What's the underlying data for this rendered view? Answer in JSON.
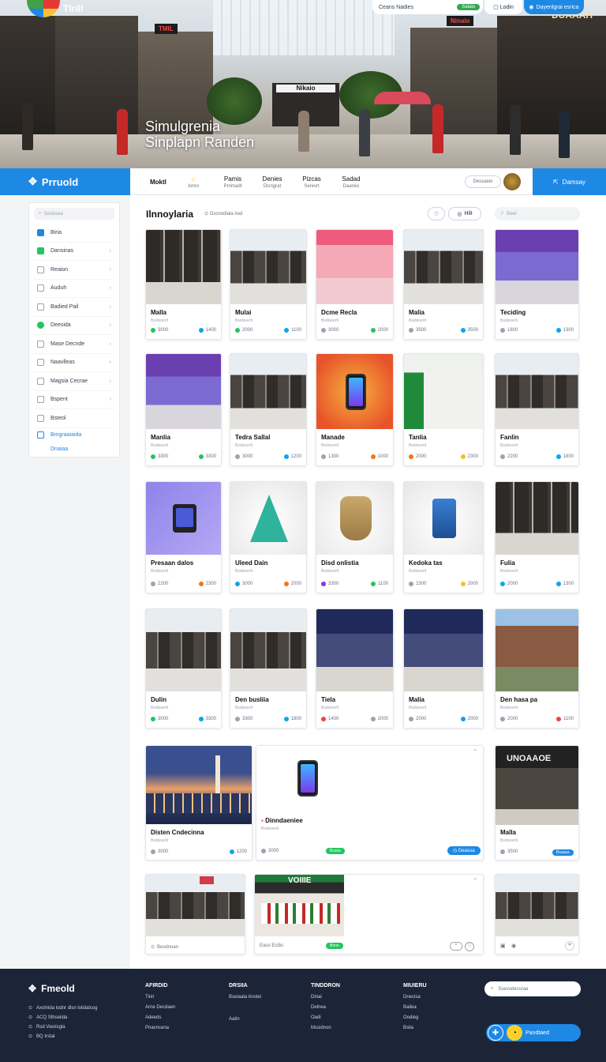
{
  "hero": {
    "logo_text": "Tlrill",
    "title_line1": "Simulgrenia",
    "title_line2": "Sinplapn Randen",
    "center_sign": "Nikaio",
    "signs": [
      "DUAAAH",
      "TMIL",
      "Ninaio"
    ],
    "search_text": "Ceans Nadies",
    "search_button": "Salaio",
    "login_label": "Lodin",
    "register_label": "Dayenlgrai esrica"
  },
  "nav": {
    "brand": "Prruold",
    "links": [
      {
        "label": "Moktl",
        "sub": ""
      },
      {
        "label": "",
        "sub": "Amro"
      },
      {
        "label": "Pamis",
        "sub": "Prnmadt"
      },
      {
        "label": "Denies",
        "sub": "Disngrat"
      },
      {
        "label": "Pizcas",
        "sub": "Serevrt"
      },
      {
        "label": "Sadad",
        "sub": "Daaries"
      }
    ],
    "mini_search": "Dessaeio",
    "cta": "Damsay"
  },
  "sidebar": {
    "search_placeholder": "Sesiosee",
    "items": [
      {
        "label": "Biria",
        "icon": "square-blue-icon",
        "chevron": false
      },
      {
        "label": "Dansinas",
        "icon": "square-green-icon",
        "chevron": true
      },
      {
        "label": "Reaion",
        "icon": "user-icon",
        "chevron": true
      },
      {
        "label": "Auduh",
        "icon": "person-icon",
        "chevron": true
      },
      {
        "label": "Badied Pail",
        "icon": "bell-icon",
        "chevron": true
      },
      {
        "label": "Deesida",
        "icon": "circle-check-icon",
        "chevron": true
      },
      {
        "label": "Mase Decnde",
        "icon": "heart-icon",
        "chevron": true
      },
      {
        "label": "Naavlleas",
        "icon": "box-icon",
        "chevron": true
      },
      {
        "label": "Magsia Cecrae",
        "icon": "shield-icon",
        "chevron": true
      },
      {
        "label": "Bspent",
        "icon": "file-icon",
        "chevron": true
      },
      {
        "label": "Bsteol",
        "icon": "grid-icon",
        "chevron": false
      }
    ],
    "links": [
      "Bmgraaiaida",
      "Dnaiaa"
    ]
  },
  "main": {
    "title": "Ilnnoylaria",
    "subtitle": "Gscnndlala lred",
    "filter_label": "Hilt",
    "search_placeholder": "Sleel"
  },
  "cards": [
    {
      "title": "Malla",
      "sub": "Bsdisoerlt",
      "a": "3000",
      "b": "1400",
      "ca": "#22c55e",
      "cb": "#0ea5e9"
    },
    {
      "title": "Mulai",
      "sub": "Bsdisoerlt",
      "a": "2000",
      "b": "1100",
      "ca": "#22c55e",
      "cb": "#0ea5e9"
    },
    {
      "title": "Dcme Recla",
      "sub": "Bsdisoerlt",
      "a": "3000",
      "b": "2000",
      "ca": "#9ca3af",
      "cb": "#22c55e"
    },
    {
      "title": "Malia",
      "sub": "Bsdisoerlt",
      "a": "3500",
      "b": "3500",
      "ca": "#9ca3af",
      "cb": "#0ea5e9"
    },
    {
      "title": "Teciding",
      "sub": "Bsdisoerlt",
      "a": "1800",
      "b": "1300",
      "ca": "#9ca3af",
      "cb": "#0ea5e9"
    },
    {
      "title": "Manlia",
      "sub": "Bsdisoerlt",
      "a": "3300",
      "b": "3300",
      "ca": "#22c55e",
      "cb": "#22c55e"
    },
    {
      "title": "Tedra Sallal",
      "sub": "Bsdisoerlt",
      "a": "3000",
      "b": "1200",
      "ca": "#9ca3af",
      "cb": "#0ea5e9"
    },
    {
      "title": "Manade",
      "sub": "Bsdisoerlt",
      "a": "1300",
      "b": "1000",
      "ca": "#9ca3af",
      "cb": "#f97316"
    },
    {
      "title": "Tanlia",
      "sub": "Bsdisoerlt",
      "a": "2000",
      "b": "2300",
      "ca": "#f97316",
      "cb": "#fbbf24"
    },
    {
      "title": "Fanlin",
      "sub": "Bsdisoerlt",
      "a": "2200",
      "b": "1800",
      "ca": "#9ca3af",
      "cb": "#0ea5e9"
    },
    {
      "title": "Presaan dalos",
      "sub": "Bsdisoerlt",
      "a": "2200",
      "b": "2300",
      "ca": "#9ca3af",
      "cb": "#f97316"
    },
    {
      "title": "Uleed Dain",
      "sub": "Bsdisoerlt",
      "a": "3000",
      "b": "2000",
      "ca": "#0ea5e9",
      "cb": "#f97316"
    },
    {
      "title": "Disd onlistia",
      "sub": "Bsdisoerlt",
      "a": "3300",
      "b": "1100",
      "ca": "#7c3aed",
      "cb": "#22c55e"
    },
    {
      "title": "Kedoka tas",
      "sub": "Bsdisoerlt",
      "a": "2300",
      "b": "2000",
      "ca": "#9ca3af",
      "cb": "#fbbf24"
    },
    {
      "title": "Fulia",
      "sub": "Bsdisoerlt",
      "a": "2000",
      "b": "1300",
      "ca": "#0ea5e9",
      "cb": "#0ea5e9"
    },
    {
      "title": "Dulin",
      "sub": "Bsdisoerlt",
      "a": "3000",
      "b": "3300",
      "ca": "#22c55e",
      "cb": "#0ea5e9"
    },
    {
      "title": "Den busliia",
      "sub": "Bsdisoerlt",
      "a": "3300",
      "b": "1800",
      "ca": "#9ca3af",
      "cb": "#0ea5e9"
    },
    {
      "title": "Tiela",
      "sub": "Bsdisoerlt",
      "a": "1400",
      "b": "2000",
      "ca": "#ef4444",
      "cb": "#9ca3af"
    },
    {
      "title": "Malia",
      "sub": "Bsdisoerlt",
      "a": "2000",
      "b": "2000",
      "ca": "#9ca3af",
      "cb": "#0ea5e9"
    },
    {
      "title": "Den hasa pa",
      "sub": "Bsdisoerlt",
      "a": "2000",
      "b": "1100",
      "ca": "#9ca3af",
      "cb": "#ef4444"
    }
  ],
  "wide": {
    "city_title": "Disten Cndecinna",
    "city_sub": "Bsdisoerlt",
    "city_a": "3000",
    "city_b": "1200",
    "phone_title": "Dinndaeniee",
    "phone_sub": "Bsdisoerlt",
    "phone_a": "3000",
    "phone_badge": "Bcans",
    "phone_btn": "Deasua",
    "store_title": "Malla",
    "store_sub": "Bsdisoerlt",
    "store_a": "3500",
    "store_btn": "Bsaasa",
    "store_sign": "UNOAAOE"
  },
  "row6": {
    "left_label": "Besdnoan",
    "mid_sign": "VOIIIE",
    "mid_label": "Easo Ecibs",
    "mid_badge": "Bonn"
  },
  "footer": {
    "brand": "Fmeold",
    "lines": [
      "Axolnida lodnr dlsn lolidalsog",
      "ACQ Sthseiida",
      "Rsd Vieolsgla",
      "BQ Irstal"
    ],
    "columns": [
      {
        "title": "AFIRDID",
        "items": [
          "Tinir",
          "Arne Decdaen",
          "Adeeds",
          "Pnavncena"
        ]
      },
      {
        "title": "DRSIIA",
        "items": [
          "Bseiaala Anstei",
          "",
          "Aatin"
        ]
      },
      {
        "title": "TINDDRON",
        "items": [
          "Dinai",
          "Delnea",
          "Oadi",
          "Mssidnon"
        ]
      },
      {
        "title": "MIUIERU",
        "items": [
          "Dnecisa",
          "Bailea",
          "Oodieg",
          "Bsila"
        ]
      }
    ],
    "search_placeholder": "Ssevudessraa",
    "cta": "Pandtaed"
  }
}
